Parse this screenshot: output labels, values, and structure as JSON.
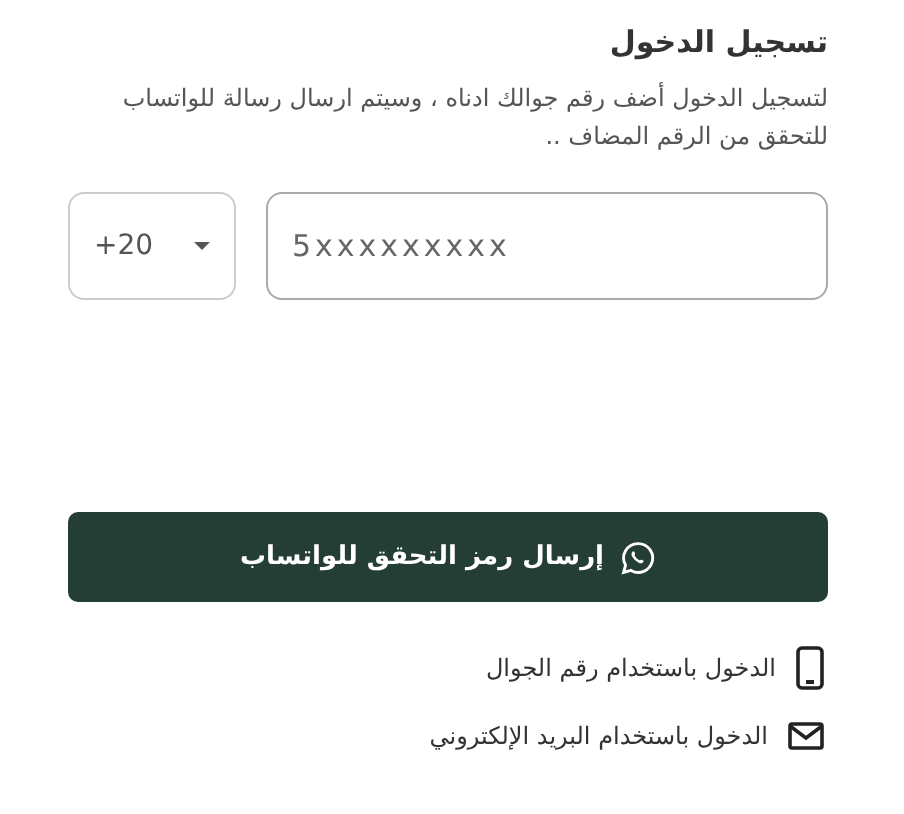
{
  "title": "تسجيل الدخول",
  "description": "لتسجيل الدخول أضف رقم جوالك ادناه ، وسيتم ارسال رسالة للواتساب للتحقق من الرقم المضاف ..",
  "country_code": {
    "value": "+20"
  },
  "phone": {
    "placeholder": "5xxxxxxxxx"
  },
  "submit_button": {
    "label": "إرسال رمز التحقق للواتساب"
  },
  "alternatives": [
    {
      "kind": "phone",
      "label": "الدخول باستخدام رقم الجوال"
    },
    {
      "kind": "email",
      "label": "الدخول باستخدام البريد الإلكتروني"
    }
  ]
}
